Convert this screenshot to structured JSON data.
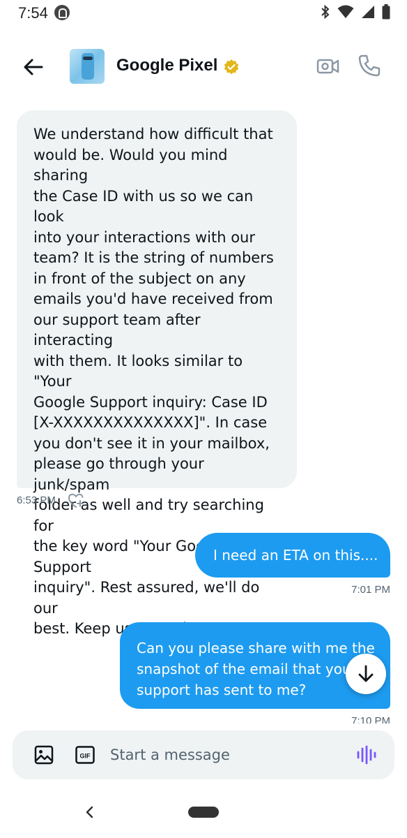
{
  "status_bar": {
    "time": "7:54"
  },
  "header": {
    "title": "Google Pixel",
    "verified": true
  },
  "messages": [
    {
      "direction": "incoming",
      "lines": [
        "We understand how difficult that",
        "would be. Would you mind sharing",
        "the Case ID with us so we can look",
        "into your interactions with our",
        "team? It is the string of numbers",
        "in front of the subject on any",
        "emails you'd have received from",
        "our support team after interacting",
        "with them. It looks similar to \"Your",
        "Google Support inquiry: Case ID",
        "[X-XXXXXXXXXXXXXX]\". In case",
        "you don't see it in your mailbox,",
        "please go through your junk/spam",
        "folder as well and try searching for",
        "the key word \"Your Google Support",
        "inquiry\". Rest assured, we'll do our",
        "best. Keep us posted."
      ],
      "time": "6:53 PM"
    },
    {
      "direction": "outgoing",
      "text": "I need an ETA on this....",
      "time": "7:01 PM"
    },
    {
      "direction": "outgoing",
      "lines": [
        "Can you please share with me the",
        "snapshot of the email that your",
        "support has sent to me?"
      ],
      "time": "7:10 PM"
    }
  ],
  "composer": {
    "placeholder": "Start a message",
    "gif_label": "GIF"
  },
  "colors": {
    "accent": "#1d9bf0",
    "incoming_bubble": "#eff3f4",
    "voice": "#7856ff",
    "verified": "#e2b719"
  },
  "icons": [
    "back-arrow",
    "verified-badge",
    "video-camera",
    "phone",
    "heart-plus",
    "arrow-down",
    "image",
    "gif",
    "voice-wave",
    "nav-back",
    "nav-home"
  ]
}
